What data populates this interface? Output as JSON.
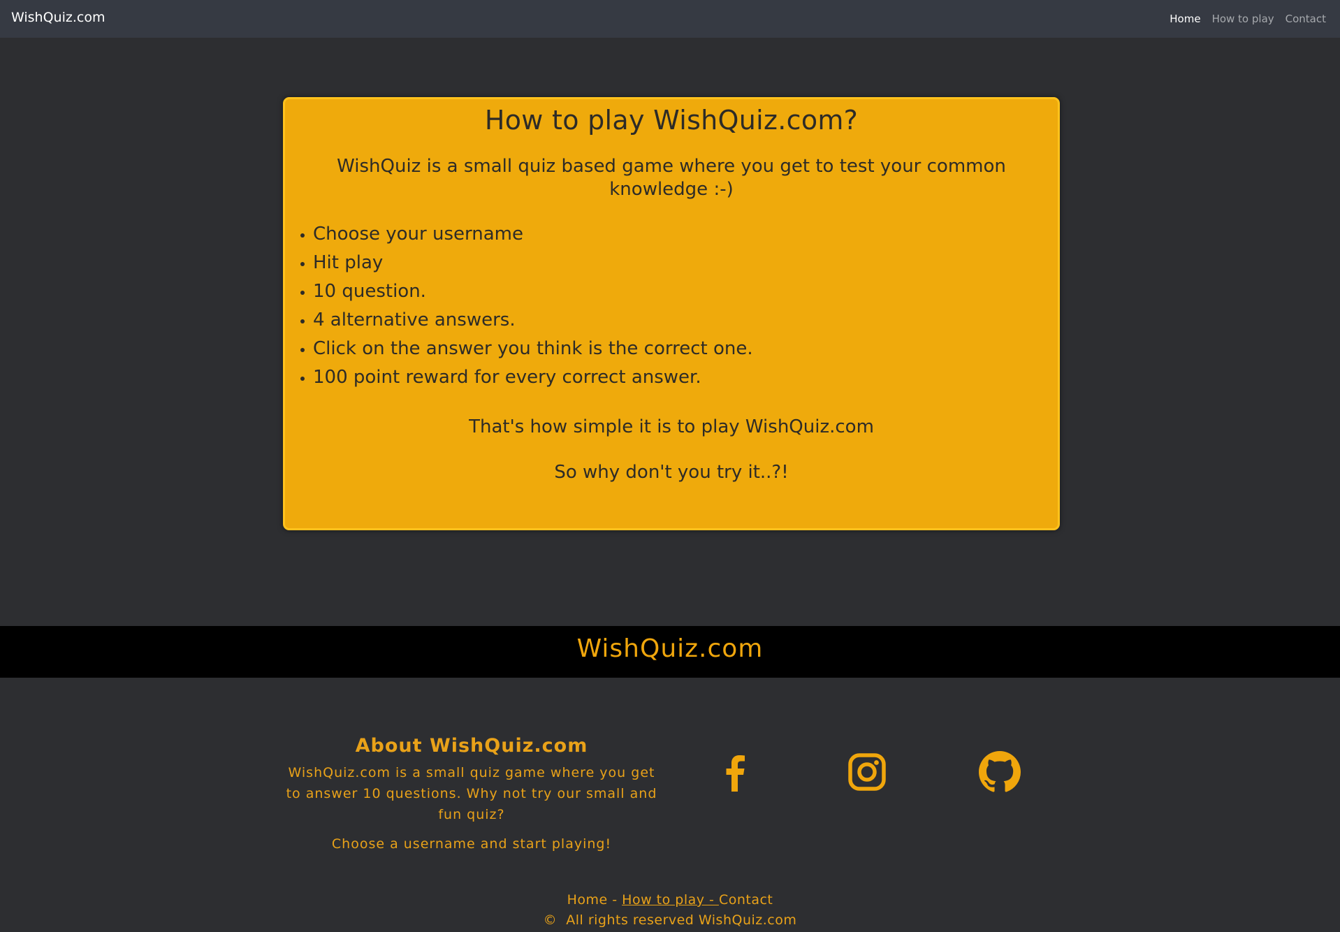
{
  "navbar": {
    "brand": "WishQuiz.com",
    "links": [
      {
        "label": "Home",
        "active": true
      },
      {
        "label": "How to play",
        "active": false
      },
      {
        "label": "Contact",
        "active": false
      }
    ]
  },
  "card": {
    "title": "How to play WishQuiz.com?",
    "intro": "WishQuiz is a small quiz based game where you get to test your common knowledge :-)",
    "steps": [
      "Choose your username",
      "Hit play",
      "10 question.",
      "4 alternative answers.",
      "Click on the answer you think is the correct one.",
      "100 point reward for every correct answer."
    ],
    "simple": "That's how simple it is to play WishQuiz.com",
    "try": "So why don't you try it..?!"
  },
  "footer": {
    "brand": "WishQuiz.com",
    "about_title": "About WishQuiz.com",
    "about_desc": "WishQuiz.com is a small quiz game where you get to answer 10 questions. Why not try our small and fun quiz?",
    "about_cta": "Choose a username and start playing!",
    "social": [
      {
        "icon": "facebook-icon"
      },
      {
        "icon": "instagram-icon"
      },
      {
        "icon": "github-icon"
      }
    ],
    "links": {
      "home": "Home",
      "sep1": " - ",
      "how": "How to play - ",
      "contact": "Contact"
    },
    "copyright_symbol": "©",
    "copyright_text": "All rights reserved WishQuiz.com",
    "accent_color": "#f0a60c"
  }
}
